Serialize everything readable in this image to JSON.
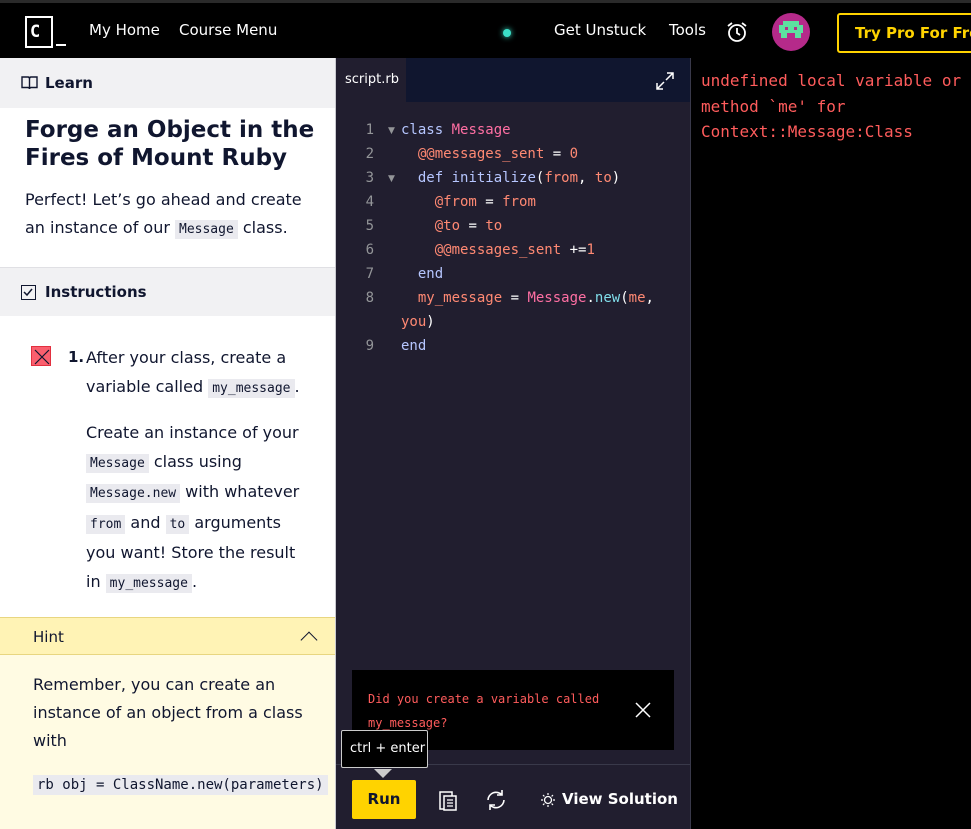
{
  "nav": {
    "home": "My Home",
    "course_menu": "Course Menu",
    "get_unstuck": "Get Unstuck",
    "tools": "Tools",
    "pro_button": "Try Pro For Free",
    "status_dot_color": "#3be0c8",
    "accent": "#ffd300"
  },
  "learn": {
    "header": "Learn",
    "title": "Forge an Object in the Fires of Mount Ruby",
    "intro_before": "Perfect! Let’s go ahead and create an instance of our ",
    "intro_code": "Message",
    "intro_after": " class."
  },
  "instructions": {
    "header": "Instructions",
    "task_number": "1.",
    "p1_before": "After your class, create a variable called ",
    "p1_code": "my_message",
    "p1_after": ".",
    "p2_a": "Create an instance of your ",
    "p2_code1": "Message",
    "p2_b": " class using ",
    "p2_code2": "Message.new",
    "p2_c": " with whatever ",
    "p2_code3": "from",
    "p2_d": " and ",
    "p2_code4": "to",
    "p2_e": " arguments you want! Store the result in ",
    "p2_code5": "my_message",
    "p2_f": ".",
    "status": "failed"
  },
  "hint": {
    "header": "Hint",
    "text": "Remember, you can create an instance of an object from a class with",
    "code": "rb obj = ClassName.new(parameters)"
  },
  "editor": {
    "tab": "script.rb",
    "line_numbers": [
      "1",
      "2",
      "3",
      "4",
      "5",
      "6",
      "7",
      "8",
      "",
      "9"
    ]
  },
  "toast": {
    "message": "Did you create a variable called my_message?"
  },
  "tooltip": "ctrl + enter",
  "bottom": {
    "run": "Run",
    "view_solution": "View Solution"
  },
  "output": {
    "error": "undefined local variable or method `me' for Context::Message:Class"
  }
}
